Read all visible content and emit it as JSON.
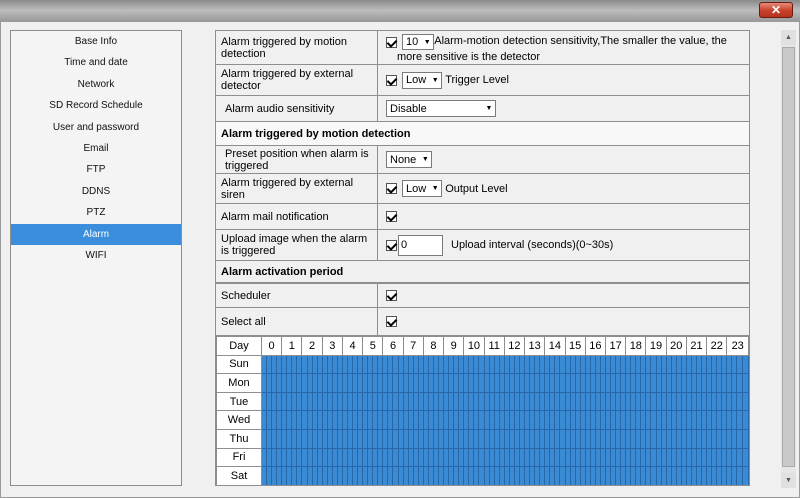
{
  "window": {
    "close_label": "✕"
  },
  "sidebar": {
    "items": [
      {
        "label": "Base Info"
      },
      {
        "label": "Time and date"
      },
      {
        "label": "Network"
      },
      {
        "label": "SD Record Schedule"
      },
      {
        "label": "User and password"
      },
      {
        "label": "Email"
      },
      {
        "label": "FTP"
      },
      {
        "label": "DDNS"
      },
      {
        "label": "PTZ"
      },
      {
        "label": "Alarm",
        "active": true
      },
      {
        "label": "WIFI"
      }
    ]
  },
  "motion": {
    "label": "Alarm triggered by motion detection",
    "checked": true,
    "value": "10",
    "note": "Alarm-motion detection sensitivity,The smaller the value, the more sensitive is the detector"
  },
  "external": {
    "label": "Alarm triggered by external detector",
    "checked": true,
    "value": "Low",
    "after": "Trigger Level"
  },
  "audio": {
    "label": "Alarm audio sensitivity",
    "value": "Disable"
  },
  "section_motion": {
    "title": "Alarm triggered by motion detection"
  },
  "preset": {
    "label": "Preset position when alarm is triggered",
    "value": "None"
  },
  "siren": {
    "label": "Alarm triggered by external siren",
    "checked": true,
    "value": "Low",
    "after": "Output Level"
  },
  "mail": {
    "label": "Alarm mail notification",
    "checked": true
  },
  "upload": {
    "label": "Upload image when the alarm is triggered",
    "checked": true,
    "value": "0",
    "after": "Upload interval (seconds)(0~30s)"
  },
  "section_period": {
    "title": "Alarm activation period"
  },
  "scheduler": {
    "label": "Scheduler",
    "checked": true
  },
  "select_all": {
    "label": "Select all",
    "checked": true
  },
  "schedule": {
    "day_header": "Day",
    "hours": [
      "0",
      "1",
      "2",
      "3",
      "4",
      "5",
      "6",
      "7",
      "8",
      "9",
      "10",
      "11",
      "12",
      "13",
      "14",
      "15",
      "16",
      "17",
      "18",
      "19",
      "20",
      "21",
      "22",
      "23"
    ],
    "days": [
      "Sun",
      "Mon",
      "Tue",
      "Wed",
      "Thu",
      "Fri",
      "Sat"
    ],
    "cells_per_hour": 4,
    "all_selected": true,
    "selected_color": "#3a8ad4"
  }
}
